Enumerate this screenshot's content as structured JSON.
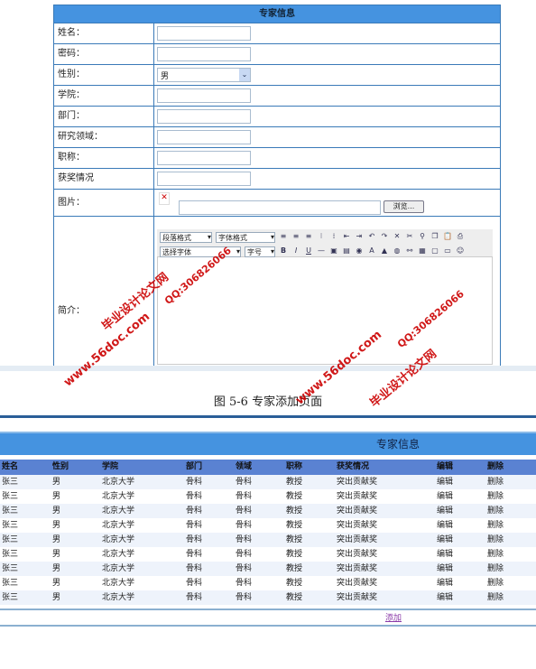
{
  "form": {
    "title": "专家信息",
    "fields": [
      {
        "label": "姓名：",
        "type": "text",
        "value": ""
      },
      {
        "label": "密码：",
        "type": "text",
        "value": ""
      },
      {
        "label": "性别：",
        "type": "select",
        "value": "男"
      },
      {
        "label": "学院：",
        "type": "text",
        "value": ""
      },
      {
        "label": "部门：",
        "type": "text",
        "value": ""
      },
      {
        "label": "研究领域：",
        "type": "text",
        "value": ""
      },
      {
        "label": "职称：",
        "type": "text",
        "value": ""
      },
      {
        "label": "获奖情况",
        "type": "text",
        "value": ""
      }
    ],
    "image_label": "图片：",
    "browse_label": "浏览...",
    "intro_label": "简介：",
    "editor": {
      "paragraph": "段落格式",
      "fontstyle": "字体格式",
      "font": "选择字体",
      "size": "字号",
      "bold": "B",
      "italic": "I",
      "underline": "U"
    }
  },
  "caption": "图 5-6 专家添加页面",
  "list": {
    "title": "专家信息",
    "columns": [
      "姓名",
      "性别",
      "学院",
      "部门",
      "领域",
      "职称",
      "获奖情况",
      "编辑",
      "删除"
    ],
    "rows": [
      [
        "张三",
        "男",
        "北京大学",
        "骨科",
        "骨科",
        "教授",
        "突出贡献奖",
        "编辑",
        "删除"
      ],
      [
        "张三",
        "男",
        "北京大学",
        "骨科",
        "骨科",
        "教授",
        "突出贡献奖",
        "编辑",
        "删除"
      ],
      [
        "张三",
        "男",
        "北京大学",
        "骨科",
        "骨科",
        "教授",
        "突出贡献奖",
        "编辑",
        "删除"
      ],
      [
        "张三",
        "男",
        "北京大学",
        "骨科",
        "骨科",
        "教授",
        "突出贡献奖",
        "编辑",
        "删除"
      ],
      [
        "张三",
        "男",
        "北京大学",
        "骨科",
        "骨科",
        "教授",
        "突出贡献奖",
        "编辑",
        "删除"
      ],
      [
        "张三",
        "男",
        "北京大学",
        "骨科",
        "骨科",
        "教授",
        "突出贡献奖",
        "编辑",
        "删除"
      ],
      [
        "张三",
        "男",
        "北京大学",
        "骨科",
        "骨科",
        "教授",
        "突出贡献奖",
        "编辑",
        "删除"
      ],
      [
        "张三",
        "男",
        "北京大学",
        "骨科",
        "骨科",
        "教授",
        "突出贡献奖",
        "编辑",
        "删除"
      ],
      [
        "张三",
        "男",
        "北京大学",
        "骨科",
        "骨科",
        "教授",
        "突出贡献奖",
        "编辑",
        "删除"
      ]
    ],
    "add_label": "添加"
  },
  "watermarks": [
    "毕业设计论文网",
    "www.56doc.com",
    "QQ:306826066"
  ],
  "colors": {
    "header": "#4593e0",
    "column_header": "#5a82d2",
    "border": "#3a7ab8",
    "watermark": "#cc0000"
  }
}
